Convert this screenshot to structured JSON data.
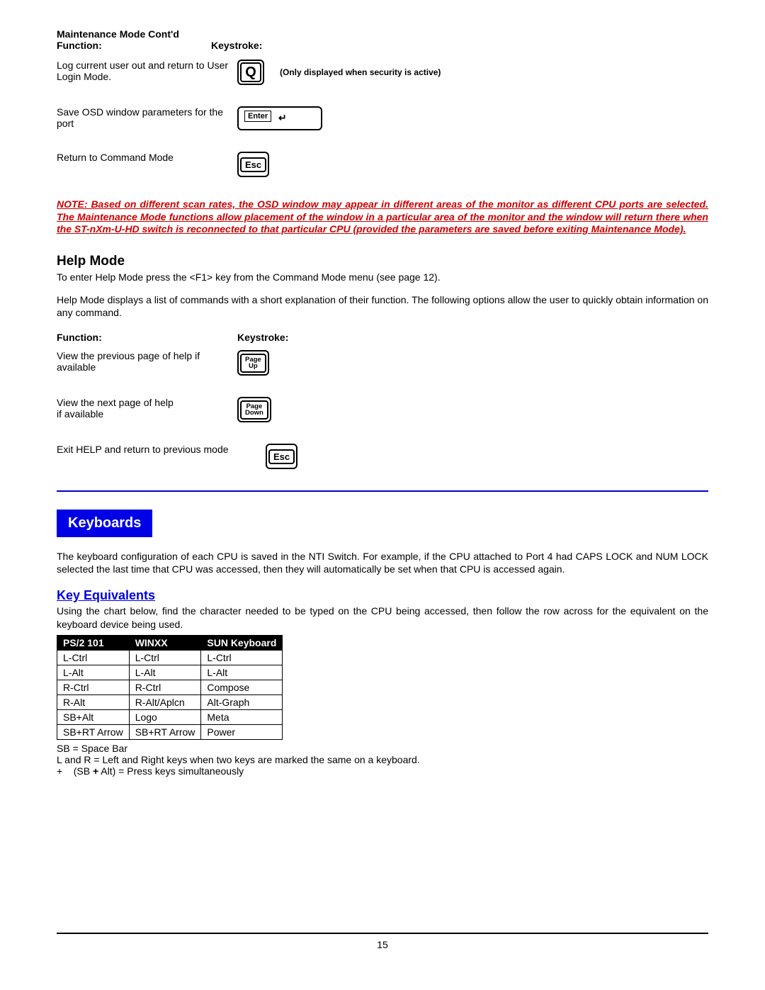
{
  "headers": {
    "maint_title": "Maintenance Mode  Cont'd",
    "function": "Function:",
    "keystroke": "Keystroke:"
  },
  "maint": {
    "r1_func": "Log current user out and return to User Login Mode.",
    "r1_key": "Q",
    "r1_note": "(Only displayed when security is active)",
    "r2_func": "Save OSD window parameters for the port",
    "r2_key": "Enter",
    "r3_func": "Return to Command Mode",
    "r3_key": "Esc"
  },
  "note": "NOTE:  Based on different scan rates, the OSD window may appear in different areas of the monitor as different CPU ports are selected.  The Maintenance Mode functions allow placement of the window in a particular area of the monitor and the window will return there when the ST-nXm-U-HD switch is reconnected to that particular CPU (provided the parameters are saved before exiting Maintenance Mode).",
  "help": {
    "title": "Help Mode",
    "p1": "To enter Help Mode press the <F1> key from the Command Mode menu (see page 12).",
    "p2": "Help Mode displays a list of commands with a short explanation of their function.   The following options allow the user to quickly obtain information on any command.",
    "func_label": "Function:",
    "key_label": "Keystroke:",
    "r1_func": "View the previous page of help if available",
    "r1_key_l1": "Page",
    "r1_key_l2": "Up",
    "r2_func": "View the next page of help",
    "r2_func_b": "if available",
    "r2_key_l1": "Page",
    "r2_key_l2": "Down",
    "r3_func": "Exit HELP and return to previous mode",
    "r3_key": "Esc"
  },
  "kbd": {
    "banner": "Keyboards",
    "p1": "The keyboard configuration of each CPU is saved in the NTI Switch.  For example, if the CPU attached to Port 4 had CAPS LOCK and NUM LOCK selected the last time that CPU was accessed, then they will automatically be set when that CPU is accessed again.",
    "sub": "Key Equivalents",
    "p2": "Using the chart below, find the character needed to be typed on the CPU being accessed, then follow the row across for the equivalent on the keyboard device being used."
  },
  "chart_data": {
    "type": "table",
    "title": "Key Equivalents",
    "columns": [
      "PS/2 101",
      "WINXX",
      "SUN Keyboard"
    ],
    "rows": [
      [
        "L-Ctrl",
        "L-Ctrl",
        "L-Ctrl"
      ],
      [
        "L-Alt",
        "L-Alt",
        "L-Alt"
      ],
      [
        "R-Ctrl",
        "R-Ctrl",
        "Compose"
      ],
      [
        "R-Alt",
        "R-Alt/Aplcn",
        "Alt-Graph"
      ],
      [
        "SB+Alt",
        "Logo",
        "Meta"
      ],
      [
        "SB+RT Arrow",
        "SB+RT Arrow",
        "Power"
      ]
    ]
  },
  "legend": {
    "l1": "SB = Space Bar",
    "l2": "L and R = Left and Right keys when two keys are marked the same on a keyboard.",
    "l3": "+    (SB + Alt) = Press keys simultaneously"
  },
  "page": "15"
}
